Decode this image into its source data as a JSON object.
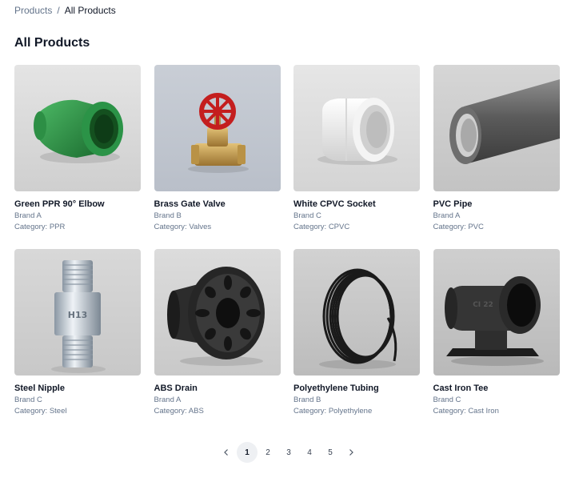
{
  "breadcrumb": {
    "parent": "Products",
    "separator": "/",
    "current": "All Products"
  },
  "page_title": "All Products",
  "products": [
    {
      "name": "Green PPR 90° Elbow",
      "brand": "Brand A",
      "category": "Category: PPR"
    },
    {
      "name": "Brass Gate Valve",
      "brand": "Brand B",
      "category": "Category: Valves"
    },
    {
      "name": "White CPVC Socket",
      "brand": "Brand C",
      "category": "Category: CPVC"
    },
    {
      "name": "PVC Pipe",
      "brand": "Brand A",
      "category": "Category: PVC"
    },
    {
      "name": "Steel Nipple",
      "brand": "Brand C",
      "category": "Category: Steel"
    },
    {
      "name": "ABS Drain",
      "brand": "Brand A",
      "category": "Category: ABS"
    },
    {
      "name": "Polyethylene Tubing",
      "brand": "Brand B",
      "category": "Category: Polyethylene"
    },
    {
      "name": "Cast Iron Tee",
      "brand": "Brand C",
      "category": "Category: Cast Iron"
    }
  ],
  "pagination": {
    "pages": [
      "1",
      "2",
      "3",
      "4",
      "5"
    ],
    "current": "1"
  },
  "colors": {
    "text": "#111827",
    "muted": "#64748b",
    "active_page_bg": "#eef0f3"
  }
}
